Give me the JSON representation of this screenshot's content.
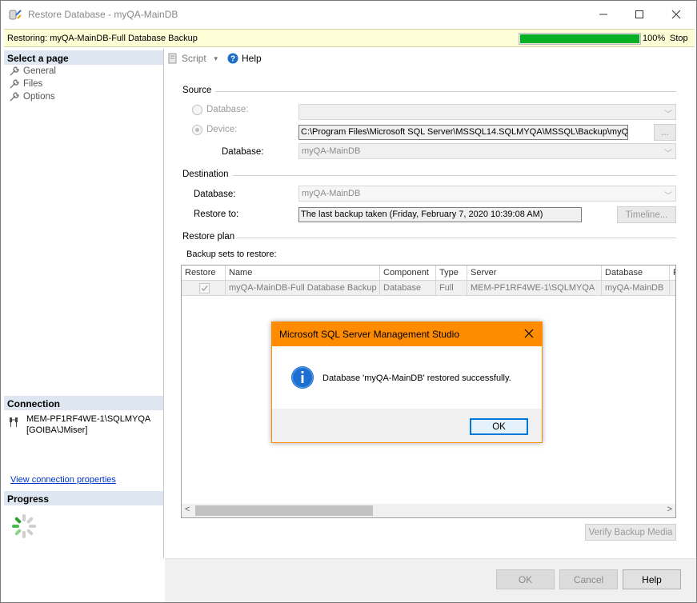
{
  "window": {
    "title": "Restore Database - myQA-MainDB"
  },
  "status": {
    "text": "Restoring: myQA-MainDB-Full Database Backup",
    "progress_percent": 100,
    "progress_label": "100%",
    "stop_label": "Stop",
    "progress_color": "#06b025"
  },
  "left_pane": {
    "select_page_header": "Select a page",
    "pages": [
      "General",
      "Files",
      "Options"
    ],
    "connection_header": "Connection",
    "connection_server": "MEM-PF1RF4WE-1\\SQLMYQA",
    "connection_user": "[GOIBA\\JMiser]",
    "view_connection_link": "View connection properties",
    "progress_header": "Progress"
  },
  "toolbar": {
    "script_label": "Script",
    "help_label": "Help"
  },
  "source": {
    "section_title": "Source",
    "database_radio_label": "Database:",
    "device_radio_label": "Device:",
    "device_path": "C:\\Program Files\\Microsoft SQL Server\\MSSQL14.SQLMYQA\\MSSQL\\Backup\\myQA",
    "browse_label": "...",
    "database_label": "Database:",
    "database_value": "myQA-MainDB"
  },
  "destination": {
    "section_title": "Destination",
    "database_label": "Database:",
    "database_value": "myQA-MainDB",
    "restore_to_label": "Restore to:",
    "restore_to_value": "The last backup taken (Friday, February 7, 2020 10:39:08 AM)",
    "timeline_label": "Timeline..."
  },
  "restore_plan": {
    "section_title": "Restore plan",
    "backup_sets_label": "Backup sets to restore:",
    "columns": [
      "Restore",
      "Name",
      "Component",
      "Type",
      "Server",
      "Database",
      "P"
    ],
    "rows": [
      {
        "restore": true,
        "name": "myQA-MainDB-Full Database Backup",
        "component": "Database",
        "type": "Full",
        "server": "MEM-PF1RF4WE-1\\SQLMYQA",
        "database": "myQA-MainDB"
      }
    ],
    "verify_label": "Verify Backup Media"
  },
  "buttons": {
    "ok": "OK",
    "cancel": "Cancel",
    "help": "Help"
  },
  "dialog": {
    "title": "Microsoft SQL Server Management Studio",
    "message": "Database 'myQA-MainDB' restored successfully.",
    "ok": "OK",
    "title_color": "#ff8c00"
  }
}
